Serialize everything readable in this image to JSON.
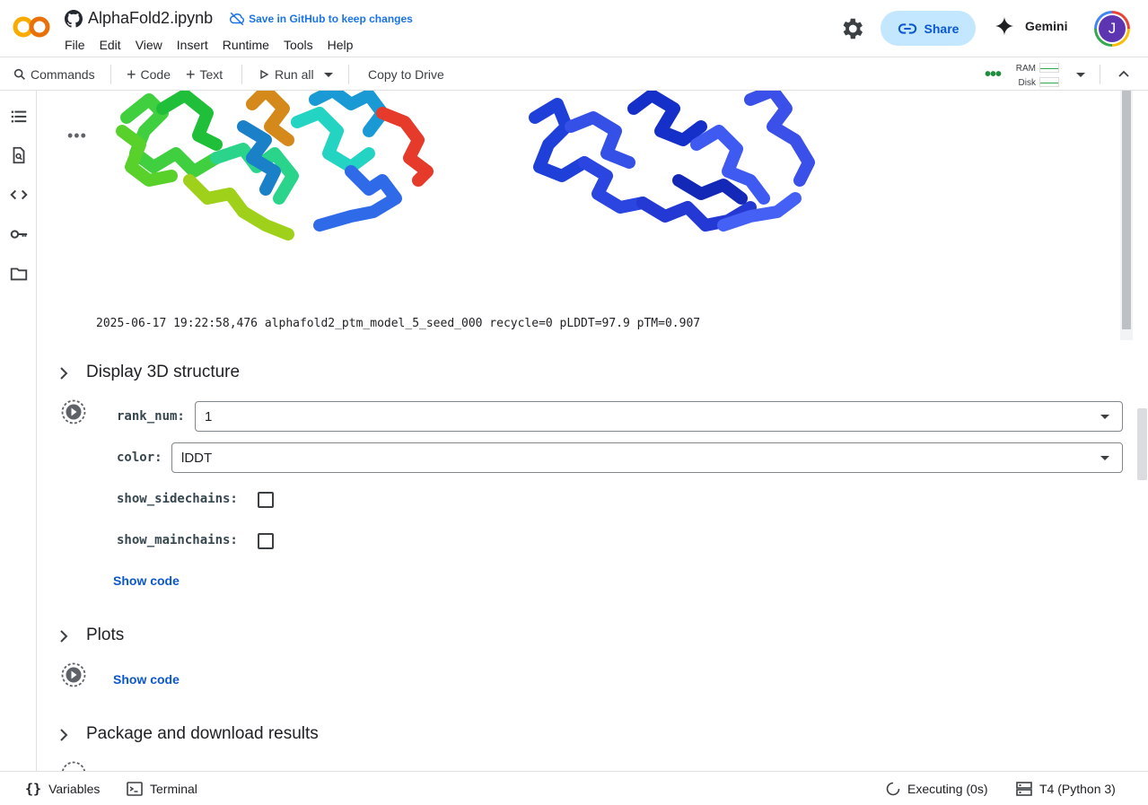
{
  "header": {
    "notebook_title": "AlphaFold2.ipynb",
    "save_github": "Save in GitHub to keep changes",
    "share": "Share",
    "gemini": "Gemini",
    "avatar_initial": "J",
    "menu": [
      "File",
      "Edit",
      "View",
      "Insert",
      "Runtime",
      "Tools",
      "Help"
    ]
  },
  "toolbar": {
    "commands": "Commands",
    "code": "Code",
    "text": "Text",
    "run_all": "Run all",
    "copy_to_drive": "Copy to Drive",
    "ram": "RAM",
    "disk": "Disk"
  },
  "output": {
    "log_line": "2025-06-17 19:22:58,476 alphafold2_ptm_model_5_seed_000 recycle=0 pLDDT=97.9 pTM=0.907"
  },
  "sections": {
    "display3d": {
      "title": "Display 3D structure",
      "rank_num_label": "rank_num:",
      "rank_num_value": "1",
      "color_label": "color:",
      "color_value": "lDDT",
      "show_sidechains_label": "show_sidechains:",
      "show_mainchains_label": "show_mainchains:",
      "show_code": "Show code"
    },
    "plots": {
      "title": "Plots",
      "show_code": "Show code"
    },
    "package": {
      "title": "Package and download results"
    }
  },
  "statusbar": {
    "variables": "Variables",
    "terminal": "Terminal",
    "executing": "Executing (0s)",
    "runtime": "T4 (Python 3)"
  },
  "colors": {
    "accent": "#1a73e8",
    "share_bg": "#c2e7ff",
    "link": "#0b57d0"
  }
}
